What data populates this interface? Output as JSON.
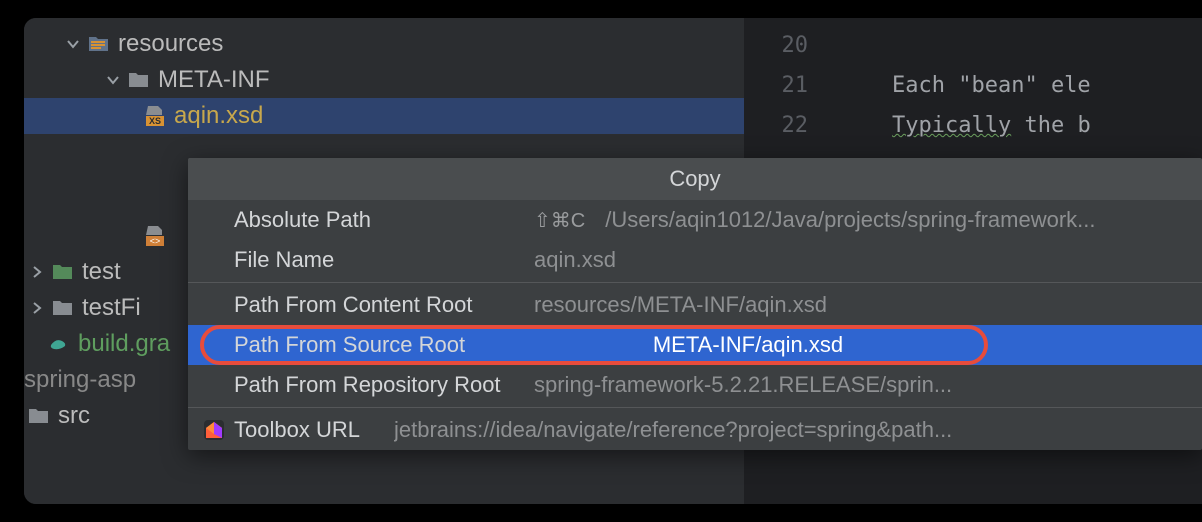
{
  "tree": {
    "resources": "resources",
    "metaInf": "META-INF",
    "aqinXsd": "aqin.xsd",
    "test": "test",
    "testFi": "testFi",
    "buildGra": "build.gra",
    "springAsp": "spring-asp",
    "src": "src"
  },
  "gutter": {
    "line20": "20",
    "line21": "21",
    "line22": "22"
  },
  "code": {
    "line21": "Each \"bean\" ele",
    "line22a": "Typically",
    "line22b": " the b"
  },
  "menu": {
    "title": "Copy",
    "items": {
      "absolutePath": {
        "label": "Absolute Path",
        "shortcut": "⇧⌘C",
        "value": "/Users/aqin1012/Java/projects/spring-framework..."
      },
      "fileName": {
        "label": "File Name",
        "value": "aqin.xsd"
      },
      "contentRoot": {
        "label": "Path From Content Root",
        "value": "resources/META-INF/aqin.xsd"
      },
      "sourceRoot": {
        "label": "Path From Source Root",
        "value": "META-INF/aqin.xsd"
      },
      "repoRoot": {
        "label": "Path From Repository Root",
        "value": "spring-framework-5.2.21.RELEASE/sprin..."
      },
      "toolbox": {
        "label": "Toolbox URL",
        "value": "jetbrains://idea/navigate/reference?project=spring&path..."
      }
    }
  }
}
